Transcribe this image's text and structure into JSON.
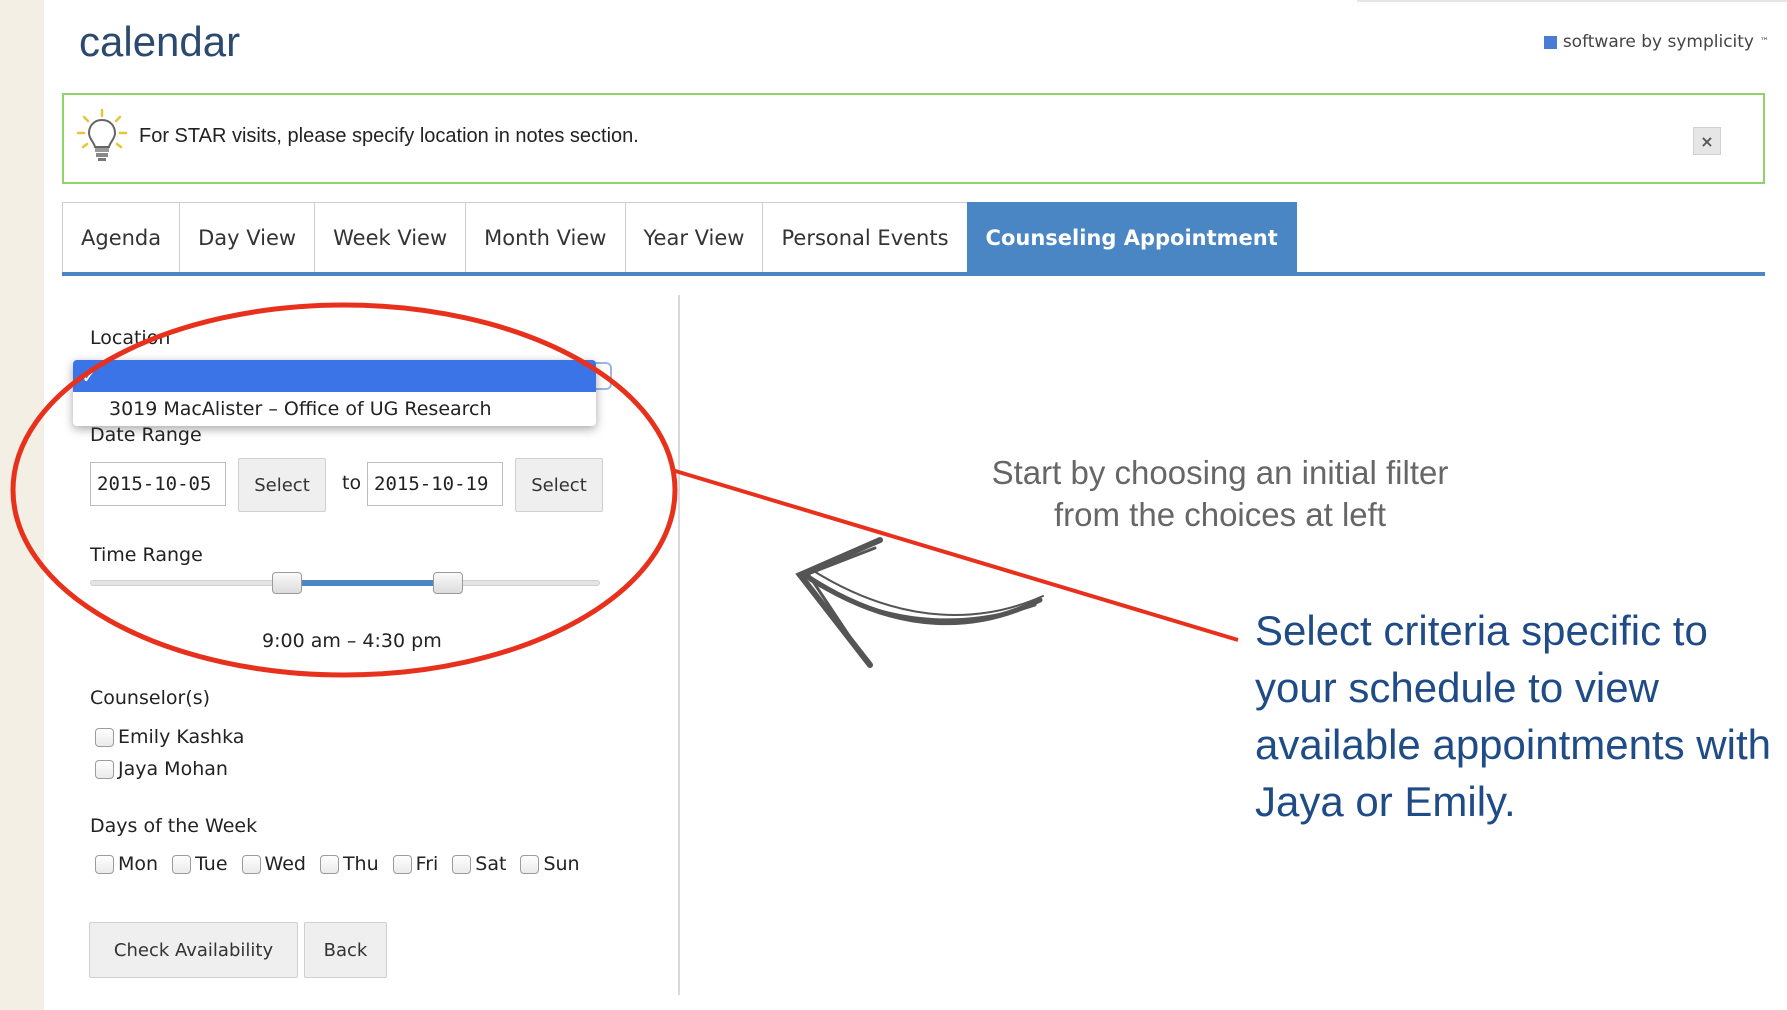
{
  "header": {
    "title": "calendar",
    "brand": "software by symplicity",
    "brand_mark": "™"
  },
  "notice": {
    "text": "For STAR visits, please specify location in notes section.",
    "close_label": "×"
  },
  "tabs": [
    {
      "label": "Agenda",
      "active": false
    },
    {
      "label": "Day View",
      "active": false
    },
    {
      "label": "Week View",
      "active": false
    },
    {
      "label": "Month View",
      "active": false
    },
    {
      "label": "Year View",
      "active": false
    },
    {
      "label": "Personal Events",
      "active": false
    },
    {
      "label": "Counseling Appointment",
      "active": true
    }
  ],
  "filters": {
    "location_label": "Location",
    "location_selected": "✓",
    "location_options": [
      "3019 MacAlister – Office of UG Research"
    ],
    "date_range_label": "Date Range",
    "date_from": "2015-10-05",
    "date_to": "2015-10-19",
    "to_label": "to",
    "select_label": "Select",
    "time_range_label": "Time Range",
    "time_range_value": "9:00 am – 4:30 pm",
    "time_range_fraction": {
      "start": 0.39,
      "end": 0.71
    },
    "counselors_label": "Counselor(s)",
    "counselors": [
      {
        "name": "Emily Kashka",
        "checked": false
      },
      {
        "name": "Jaya Mohan",
        "checked": false
      }
    ],
    "days_label": "Days of the Week",
    "days": [
      {
        "name": "Mon",
        "checked": false
      },
      {
        "name": "Tue",
        "checked": false
      },
      {
        "name": "Wed",
        "checked": false
      },
      {
        "name": "Thu",
        "checked": false
      },
      {
        "name": "Fri",
        "checked": false
      },
      {
        "name": "Sat",
        "checked": false
      },
      {
        "name": "Sun",
        "checked": false
      }
    ],
    "check_availability_label": "Check Availability",
    "back_label": "Back"
  },
  "hint": {
    "line1": "Start by choosing an initial filter",
    "line2": "from the choices at left"
  },
  "callout": {
    "text": "Select criteria specific to your schedule to view available appointments with Jaya or Emily."
  },
  "colors": {
    "accent": "#4a86c4",
    "notice_border": "#8fd36a",
    "annotation_red": "#e8311d",
    "callout_blue": "#1f4b86"
  }
}
